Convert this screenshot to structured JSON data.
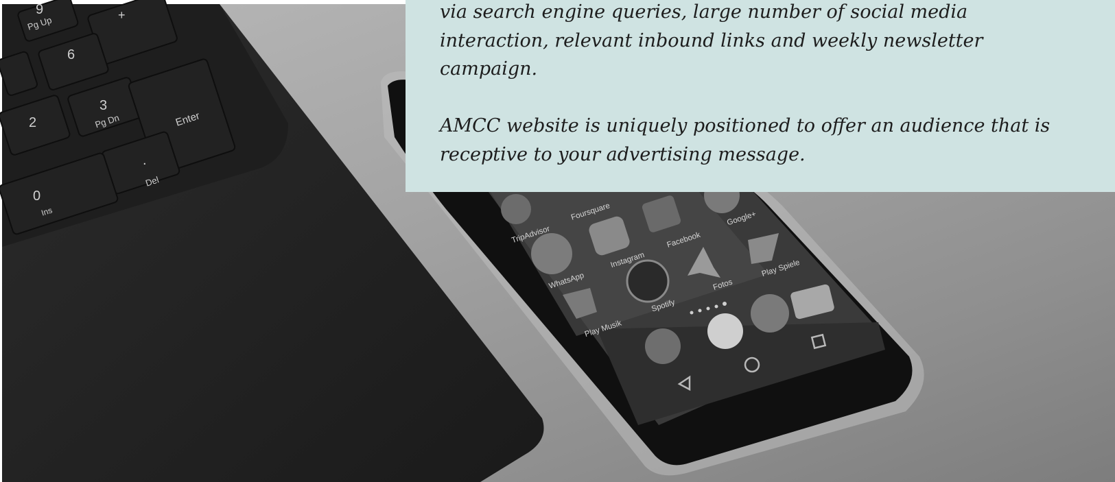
{
  "panel": {
    "paragraph_1": "via search engine queries, large number of social media interaction, relevant inbound links and weekly newsletter campaign.",
    "paragraph_2": "AMCC website is uniquely positioned to offer an audience that is receptive to your advertising message."
  },
  "keyboard": {
    "keys": [
      "9",
      "Pg Up",
      "+",
      "6",
      "3",
      "Pg Dn",
      "Enter",
      "2",
      ".",
      "Del",
      "0",
      "Ins"
    ]
  },
  "phone": {
    "apps": [
      "TripAdvisor",
      "Foursquare",
      "Facebook",
      "Google+",
      "WhatsApp",
      "Instagram",
      "Play Spiele",
      "Fotos",
      "Spotify",
      "Play Musik"
    ]
  }
}
